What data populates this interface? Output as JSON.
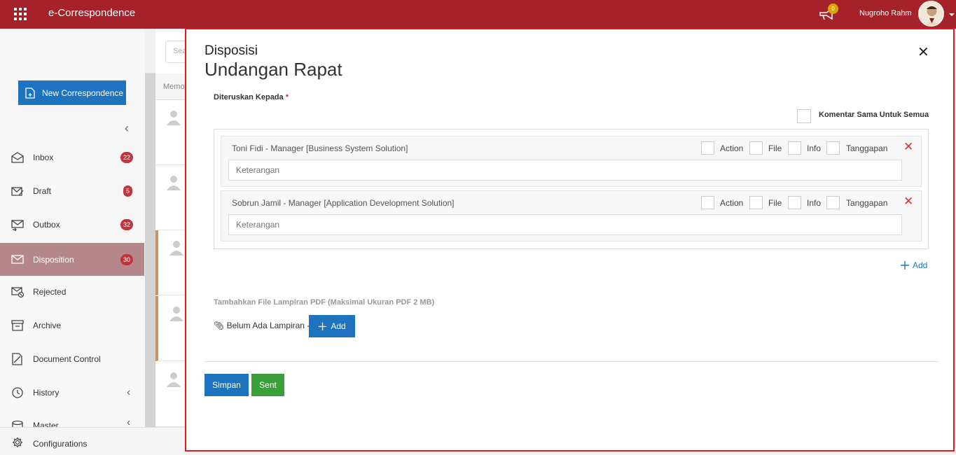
{
  "app": {
    "title": "e-Correspondence"
  },
  "header": {
    "user_name": "Nugroho Rahm",
    "notif_count": "0"
  },
  "sidebar": {
    "new_button": "New Correspondence",
    "items": [
      {
        "label": "Inbox",
        "badge": "22",
        "icon": "inbox-icon"
      },
      {
        "label": "Draft",
        "badge": "5",
        "icon": "draft-icon"
      },
      {
        "label": "Outbox",
        "badge": "32",
        "icon": "outbox-icon"
      },
      {
        "label": "Disposition",
        "badge": "30",
        "icon": "disposition-icon",
        "active": true
      },
      {
        "label": "Rejected",
        "icon": "rejected-icon"
      },
      {
        "label": "Archive",
        "icon": "archive-icon"
      },
      {
        "label": "Document Control",
        "icon": "document-control-icon"
      },
      {
        "label": "History",
        "icon": "history-icon"
      },
      {
        "label": "Master",
        "icon": "master-icon"
      }
    ],
    "configurations": "Configurations"
  },
  "list": {
    "search_placeholder": "Sea",
    "column_header": "Memo"
  },
  "modal": {
    "title": "Disposisi",
    "subtitle": "Undangan Rapat",
    "forward_label": "Diteruskan Kepada",
    "required_mark": "*",
    "same_comment_label": "Komentar Sama Untuk Semua",
    "option_labels": {
      "action": "Action",
      "file": "File",
      "info": "Info",
      "tanggapan": "Tanggapan"
    },
    "recipients": [
      {
        "name": "Toni Fidi - Manager [Business System Solution]",
        "placeholder": "Keterangan"
      },
      {
        "name": "Sobrun Jamil - Manager [Application Development Solution]",
        "placeholder": "Keterangan"
      }
    ],
    "add_recipient_label": "Add",
    "attachment_label": "Tambahkan File Lampiran PDF (Maksimal Ukuran PDF 2 MB)",
    "attachment_status": "Belum Ada Lampiran -",
    "attachment_add_label": "Add",
    "save_label": "Simpan",
    "sent_label": "Sent"
  },
  "colors": {
    "brand": "#a6222b",
    "primary": "#1e73be",
    "success": "#3a9e3a",
    "danger": "#d9302d"
  }
}
